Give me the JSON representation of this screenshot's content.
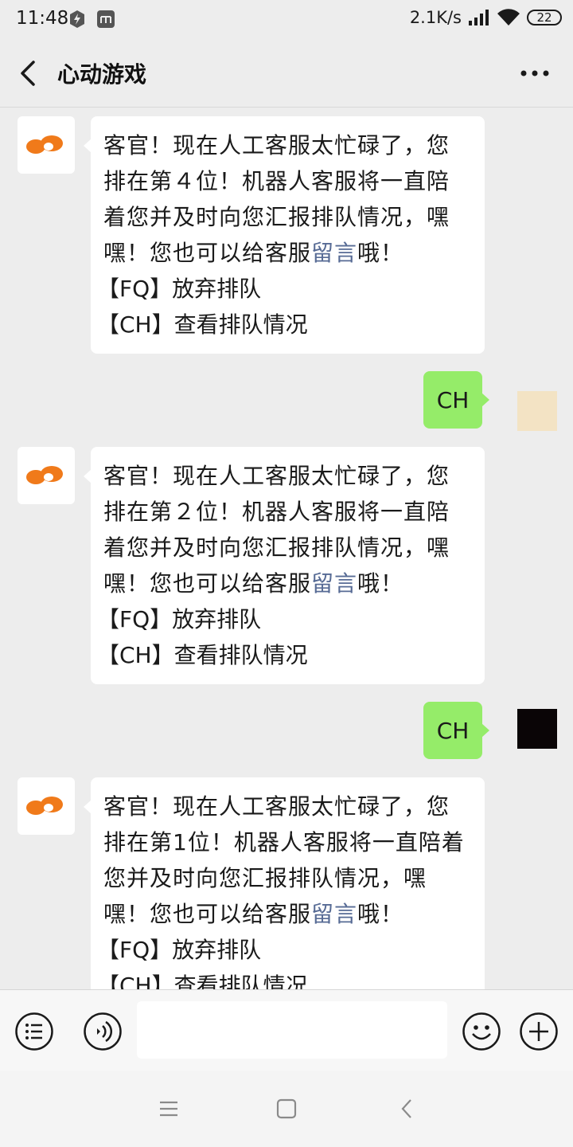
{
  "status_bar": {
    "time": "11:48",
    "net_speed": "2.1K/s",
    "battery": "22"
  },
  "header": {
    "title": "心动游戏"
  },
  "messages": [
    {
      "sender": "bot",
      "text_pre": "客官！现在人工客服太忙碌了，您排在第４位！机器人客服将一直陪着您并及时向您汇报排队情况，嘿嘿！您也可以给客服",
      "link": "留言",
      "text_post": "哦！",
      "cmd1": "【FQ】放弃排队",
      "cmd2": "【CH】查看排队情况"
    },
    {
      "sender": "user",
      "text": "CH"
    },
    {
      "sender": "bot",
      "text_pre": "客官！现在人工客服太忙碌了，您排在第２位！机器人客服将一直陪着您并及时向您汇报排队情况，嘿嘿！您也可以给客服",
      "link": "留言",
      "text_post": "哦！",
      "cmd1": "【FQ】放弃排队",
      "cmd2": "【CH】查看排队情况"
    },
    {
      "sender": "user",
      "text": "CH"
    },
    {
      "sender": "bot",
      "text_pre": "客官！现在人工客服太忙碌了，您排在第1位！机器人客服将一直陪着您并及时向您汇报排队情况，嘿嘿！您也可以给客服",
      "link": "留言",
      "text_post": "哦！",
      "cmd1": "【FQ】放弃排队",
      "cmd2": "【CH】查看排队情况"
    }
  ],
  "input": {
    "value": "",
    "placeholder": ""
  },
  "icons": {
    "menu": "list-menu-icon",
    "voice": "voice-icon",
    "emoji": "emoji-icon",
    "more": "plus-icon"
  },
  "colors": {
    "user_bubble": "#95ec69",
    "link": "#576b95",
    "brand_orange": "#f07a1a"
  }
}
